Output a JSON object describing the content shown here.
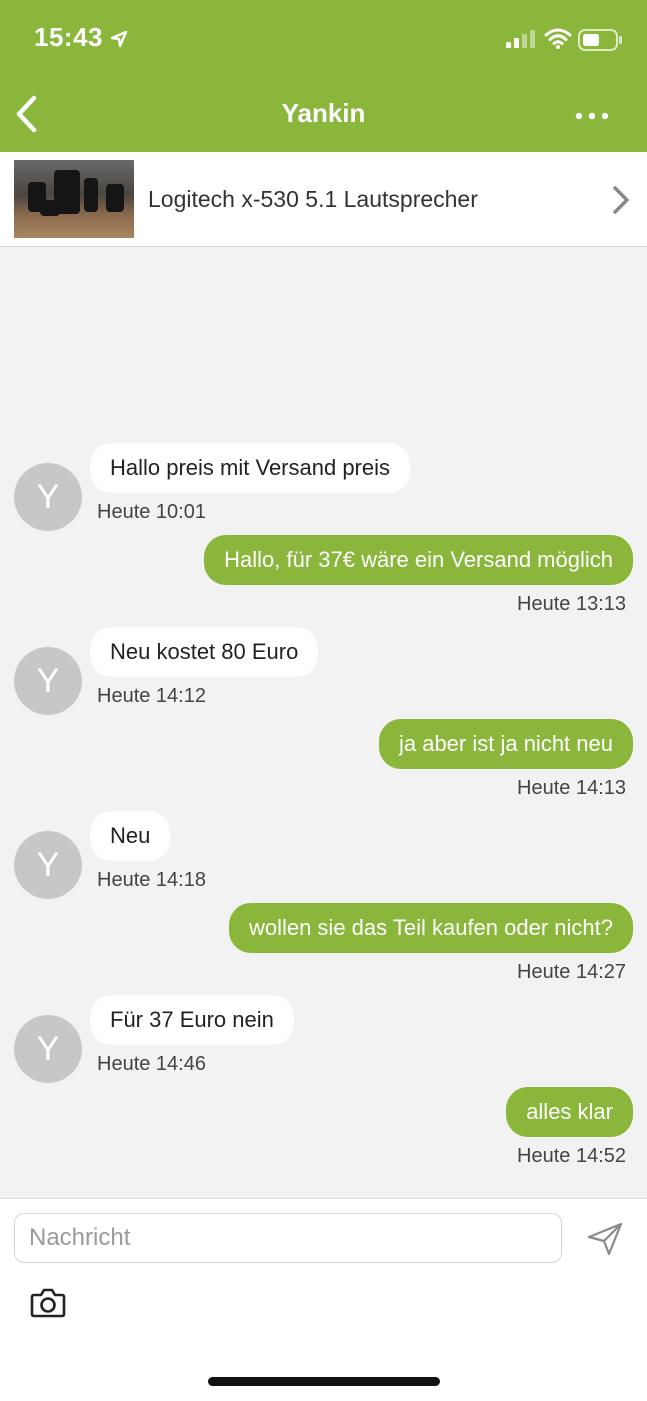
{
  "status_bar": {
    "time": "15:43"
  },
  "header": {
    "title": "Yankin"
  },
  "product": {
    "name": "Logitech x-530 5.1 Lautsprecher"
  },
  "messages": [
    {
      "direction": "in",
      "avatar": "Y",
      "text": "Hallo preis mit Versand preis",
      "time": "Heute 10:01"
    },
    {
      "direction": "out",
      "text": "Hallo, für 37€ wäre ein Versand möglich",
      "time": "Heute 13:13"
    },
    {
      "direction": "in",
      "avatar": "Y",
      "text": "Neu kostet 80 Euro",
      "time": "Heute 14:12"
    },
    {
      "direction": "out",
      "text": "ja aber ist ja nicht neu",
      "time": "Heute 14:13"
    },
    {
      "direction": "in",
      "avatar": "Y",
      "text": "Neu",
      "time": "Heute 14:18"
    },
    {
      "direction": "out",
      "text": "wollen sie das Teil kaufen oder nicht?",
      "time": "Heute 14:27"
    },
    {
      "direction": "in",
      "avatar": "Y",
      "text": "Für 37 Euro nein",
      "time": "Heute 14:46"
    },
    {
      "direction": "out",
      "text": "alles klar",
      "time": "Heute 14:52"
    }
  ],
  "composer": {
    "placeholder": "Nachricht"
  },
  "icons": {
    "back": "chevron-left-icon",
    "more": "more-dots-icon",
    "product_chevron": "chevron-right-icon",
    "send": "send-icon",
    "camera": "camera-icon"
  },
  "colors": {
    "brand": "#8bb63c",
    "incoming_bubble": "#ffffff",
    "avatar": "#c7c7c7"
  }
}
